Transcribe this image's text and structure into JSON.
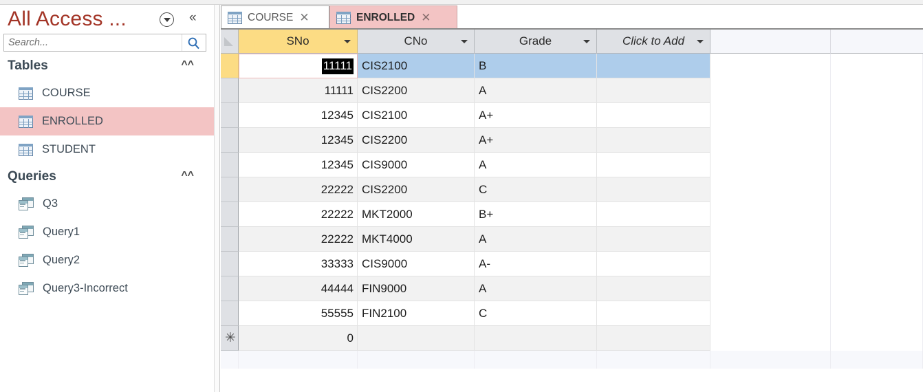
{
  "nav_pane": {
    "title": "All Access ...",
    "dropdown_icon": "circle-chevron-down-icon",
    "collapse_icon": "double-chevron-left-icon",
    "search": {
      "placeholder": "Search...",
      "value": "",
      "icon": "magnifier-icon"
    },
    "groups": [
      {
        "label": "Tables",
        "chevron_icon": "double-chevron-up-icon",
        "items": [
          {
            "label": "COURSE",
            "icon": "table-icon",
            "selected": false
          },
          {
            "label": "ENROLLED",
            "icon": "table-icon",
            "selected": true
          },
          {
            "label": "STUDENT",
            "icon": "table-icon",
            "selected": false
          }
        ]
      },
      {
        "label": "Queries",
        "chevron_icon": "double-chevron-up-icon",
        "items": [
          {
            "label": "Q3",
            "icon": "query-icon",
            "selected": false
          },
          {
            "label": "Query1",
            "icon": "query-icon",
            "selected": false
          },
          {
            "label": "Query2",
            "icon": "query-icon",
            "selected": false
          },
          {
            "label": "Query3-Incorrect",
            "icon": "query-icon",
            "selected": false
          }
        ]
      }
    ]
  },
  "tabs": [
    {
      "label": "COURSE",
      "icon": "table-icon",
      "close_icon": "close-icon",
      "active": false
    },
    {
      "label": "ENROLLED",
      "icon": "table-icon",
      "close_icon": "close-icon",
      "active": true
    }
  ],
  "datasheet": {
    "columns": [
      {
        "name": "SNo",
        "sorted": true,
        "align": "right",
        "caret_icon": "chevron-down-icon"
      },
      {
        "name": "CNo",
        "sorted": false,
        "align": "left",
        "caret_icon": "chevron-down-icon"
      },
      {
        "name": "Grade",
        "sorted": false,
        "align": "left",
        "caret_icon": "chevron-down-icon"
      },
      {
        "name": "Click to Add",
        "sorted": false,
        "align": "left",
        "caret_icon": "chevron-down-icon"
      }
    ],
    "rows": [
      {
        "SNo": "11111",
        "CNo": "CIS2100",
        "Grade": "B",
        "selected": true
      },
      {
        "SNo": "11111",
        "CNo": "CIS2200",
        "Grade": "A",
        "selected": false
      },
      {
        "SNo": "12345",
        "CNo": "CIS2100",
        "Grade": "A+",
        "selected": false
      },
      {
        "SNo": "12345",
        "CNo": "CIS2200",
        "Grade": "A+",
        "selected": false
      },
      {
        "SNo": "12345",
        "CNo": "CIS9000",
        "Grade": "A",
        "selected": false
      },
      {
        "SNo": "22222",
        "CNo": "CIS2200",
        "Grade": "C",
        "selected": false
      },
      {
        "SNo": "22222",
        "CNo": "MKT2000",
        "Grade": "B+",
        "selected": false
      },
      {
        "SNo": "22222",
        "CNo": "MKT4000",
        "Grade": "A",
        "selected": false
      },
      {
        "SNo": "33333",
        "CNo": "CIS9000",
        "Grade": "A-",
        "selected": false
      },
      {
        "SNo": "44444",
        "CNo": "FIN9000",
        "Grade": "A",
        "selected": false
      },
      {
        "SNo": "55555",
        "CNo": "FIN2100",
        "Grade": "C",
        "selected": false
      }
    ],
    "new_record": {
      "SNo": "0",
      "CNo": "",
      "Grade": "",
      "marker_icon": "asterisk-new-record-icon"
    },
    "active_cell": {
      "row": 0,
      "column": "SNo",
      "value": "11111"
    },
    "colors": {
      "sorted_header": "#fcdc84",
      "header": "#dfe1e5",
      "row_selected": "#aecdeb",
      "alt_row": "#f2f2f2",
      "active_tab": "#f3c4c4",
      "nav_title": "#a33527"
    }
  }
}
